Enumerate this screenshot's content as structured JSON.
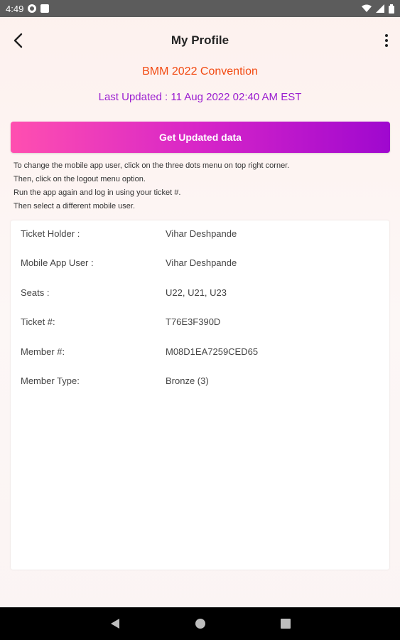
{
  "status_bar": {
    "time": "4:49",
    "icons": [
      "notification-icon",
      "sim-icon",
      "wifi-icon",
      "cell-signal-icon",
      "battery-icon"
    ]
  },
  "app_bar": {
    "title": "My Profile",
    "back_icon": "arrow-left-icon",
    "menu_icon": "more-vert-icon"
  },
  "event": {
    "name": "BMM 2022 Convention",
    "last_updated": "Last Updated : 11 Aug 2022 02:40 AM EST",
    "name_color": "#f24a12",
    "last_updated_color": "#9b1fd0"
  },
  "update_button": {
    "label": "Get Updated data",
    "gradient_start": "#ff4fb0",
    "gradient_end": "#9f08cf"
  },
  "instructions": [
    "To change the mobile app user, click on the three dots menu on top right corner.",
    "Then, click on the logout menu option.",
    "Run the app again and log in using your ticket #.",
    "Then select a different mobile user."
  ],
  "profile": {
    "rows": [
      {
        "label": "Ticket Holder :",
        "value": "Vihar Deshpande"
      },
      {
        "label": "Mobile App User :",
        "value": "Vihar Deshpande"
      },
      {
        "label": "Seats :",
        "value": "U22, U21, U23"
      },
      {
        "label": "Ticket #:",
        "value": "T76E3F390D"
      },
      {
        "label": "Member #:",
        "value": "M08D1EA7259CED65"
      },
      {
        "label": "Member Type:",
        "value": "Bronze (3)"
      }
    ]
  },
  "nav_bar": {
    "icons": [
      "back-triangle-icon",
      "home-circle-icon",
      "recents-square-icon"
    ]
  }
}
